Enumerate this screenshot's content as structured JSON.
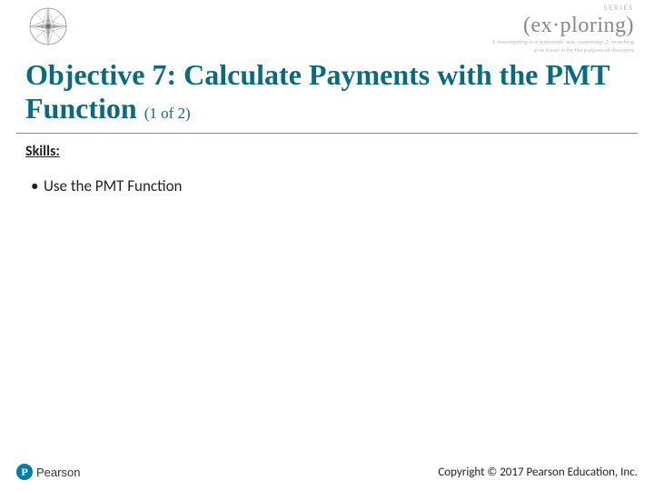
{
  "header": {
    "series_label": "SERIES",
    "exploring_word": "(ex·ploring)",
    "tagline_line1": "1. investigating in a systematic way; examining; 2. searching",
    "tagline_line2": "in or travel in for the purpose of discovery"
  },
  "title": {
    "main": "Objective 7: Calculate Payments with the PMT Function",
    "part": "(1 of 2)"
  },
  "body": {
    "skills_label": "Skills:",
    "bullets": [
      "Use the PMT Function"
    ]
  },
  "footer": {
    "pearson": "Pearson",
    "copyright": "Copyright © 2017 Pearson Education, Inc."
  }
}
